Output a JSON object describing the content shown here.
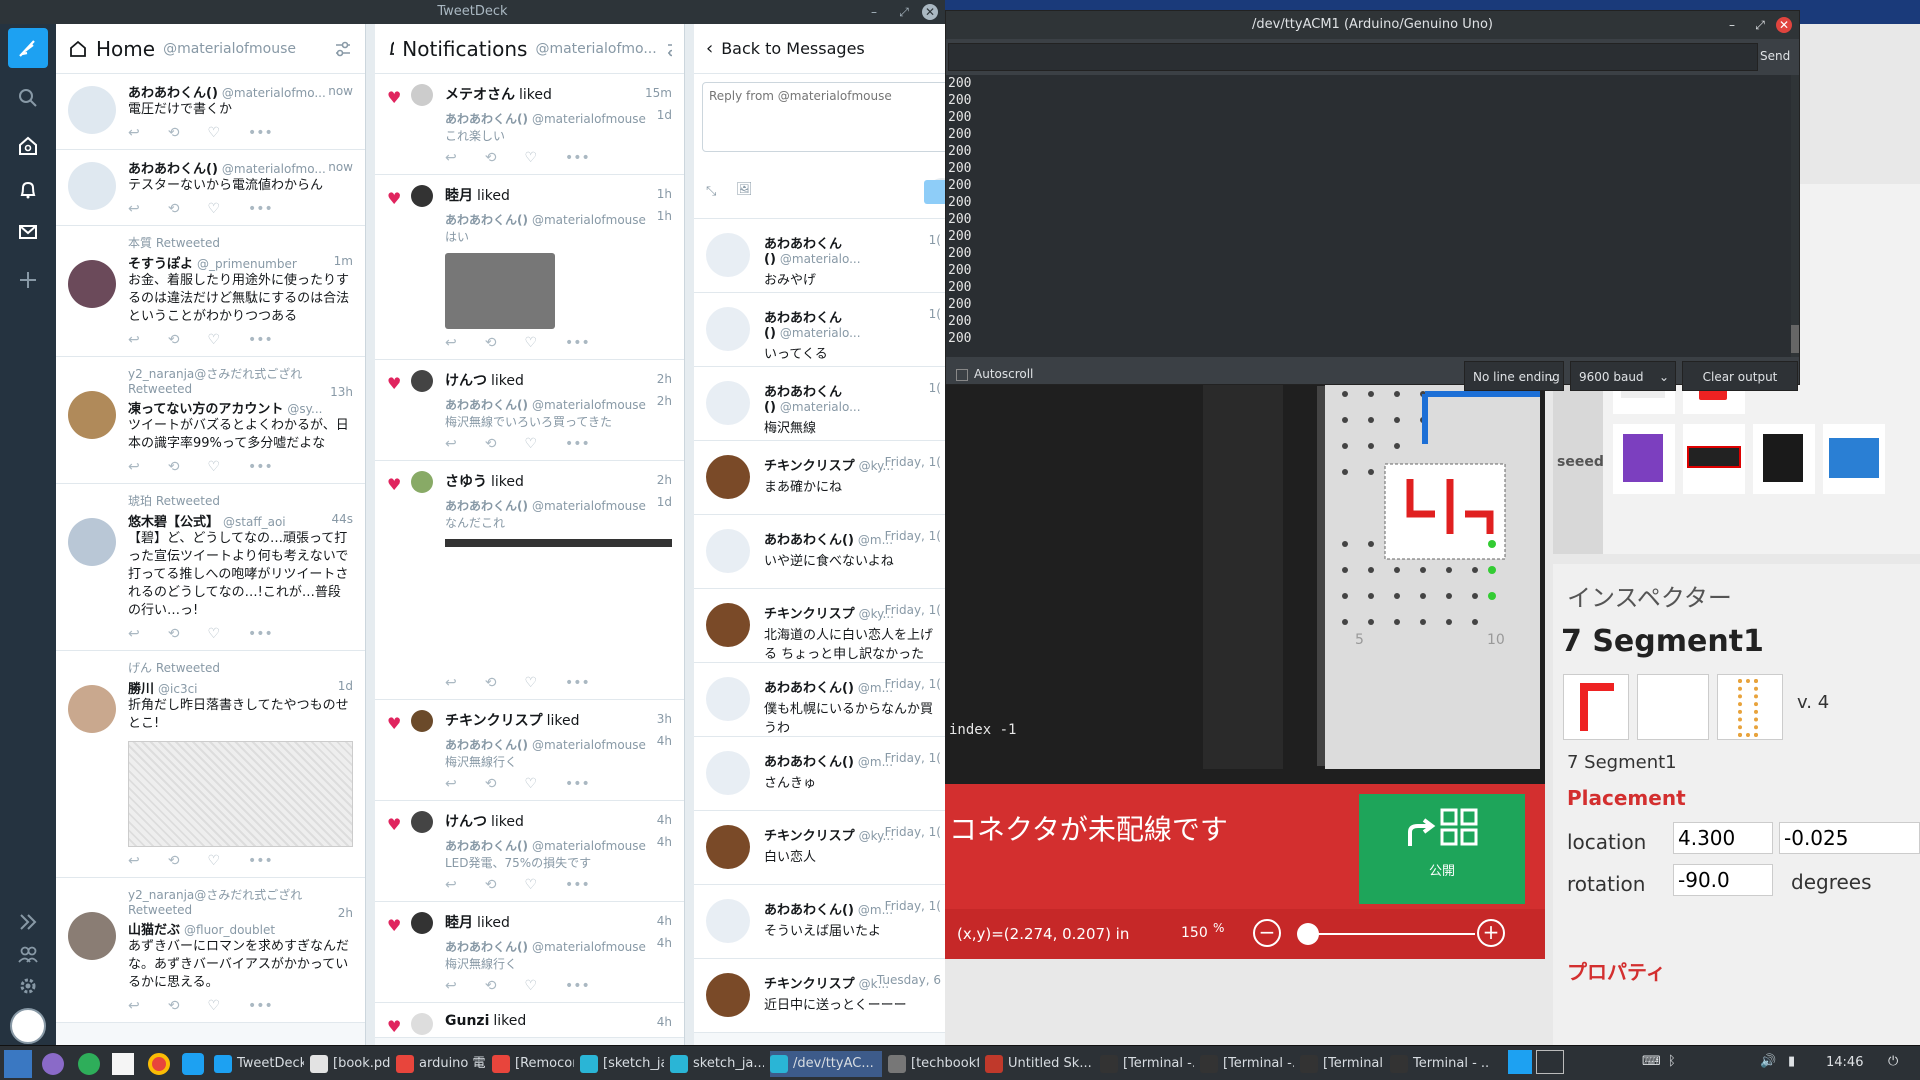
{
  "tweetdeck": {
    "window_title": "TweetDeck",
    "home": {
      "title": "Home",
      "handle": "@materialofmouse",
      "tweets": [
        {
          "retweeter": "",
          "name": "あわあわくん()",
          "handle": "@materialofmo...",
          "time": "now",
          "text": "電圧だけで書くか"
        },
        {
          "retweeter": "",
          "name": "あわあわくん()",
          "handle": "@materialofmo...",
          "time": "now",
          "text": "テスターないから電流値わからん"
        },
        {
          "retweeter": "本質 Retweeted",
          "name": "そすうぽよ",
          "handle": "@_primenumber",
          "time": "1m",
          "text": "お金、着服したり用途外に使ったりするのは違法だけど無駄にするのは合法ということがわかりつつある"
        },
        {
          "retweeter": "y2_naranja@さみだれ式ござれ Retweeted",
          "name": "凍ってない方のアカウント",
          "handle": "@sy...",
          "time": "13h",
          "text": "ツイートがバズるとよくわかるが、日本の識字率99%って多分嘘だよな"
        },
        {
          "retweeter": "琥珀 Retweeted",
          "name": "悠木碧【公式】",
          "handle": "@staff_aoi",
          "time": "44s",
          "text": "【碧】ど、どうしてなの…頑張って打った宣伝ツイートより何も考えないで打ってる推しへの咆哮がリツイートされるのどうしてなの…!これが…普段の行い…っ!"
        },
        {
          "retweeter": "げん Retweeted",
          "name": "勝川",
          "handle": "@ic3ci",
          "time": "1d",
          "text": "折角だし昨日落書きしてたやつものせとこ!"
        },
        {
          "retweeter": "y2_naranja@さみだれ式ござれ Retweeted",
          "name": "山猫だぶ",
          "handle": "@fluor_doublet",
          "time": "2h",
          "text": "あずきバーにロマンを求めすぎなんだな。あずきバーバイアスがかかっているかに思える。"
        }
      ]
    },
    "notifications": {
      "title": "Notifications",
      "handle": "@materialofmo...",
      "items": [
        {
          "who": "メテオさん",
          "action": "liked",
          "time": "15m",
          "time2": "1d",
          "sub_name": "あわあわくん()",
          "sub_handle": "@materialofmouse",
          "text": "これ楽しい"
        },
        {
          "who": "睦月",
          "action": "liked",
          "time": "1h",
          "time2": "1h",
          "sub_name": "あわあわくん()",
          "sub_handle": "@materialofmouse",
          "text": "はい"
        },
        {
          "who": "けんつ",
          "action": "liked",
          "time": "2h",
          "time2": "2h",
          "sub_name": "あわあわくん()",
          "sub_handle": "@materialofmouse",
          "text": "梅沢無線でいろいろ買ってきた"
        },
        {
          "who": "さゆう",
          "action": "liked",
          "time": "2h",
          "time2": "1d",
          "sub_name": "あわあわくん()",
          "sub_handle": "@materialofmouse",
          "text": "なんだこれ"
        },
        {
          "who": "チキンクリスプ",
          "action": "liked",
          "time": "3h",
          "time2": "4h",
          "sub_name": "あわあわくん()",
          "sub_handle": "@materialofmouse",
          "text": "梅沢無線行く"
        },
        {
          "who": "けんつ",
          "action": "liked",
          "time": "4h",
          "time2": "4h",
          "sub_name": "あわあわくん()",
          "sub_handle": "@materialofmouse",
          "text": "LED発電、75%の損失です"
        },
        {
          "who": "睦月",
          "action": "liked",
          "time": "4h",
          "time2": "4h",
          "sub_name": "あわあわくん()",
          "sub_handle": "@materialofmouse",
          "text": "梅沢無線行く"
        },
        {
          "who": "Gunzi",
          "action": "liked",
          "time": "4h",
          "time2": "",
          "sub_name": "",
          "sub_handle": "",
          "text": ""
        }
      ]
    },
    "messages": {
      "back_label": "Back to Messages",
      "reply_placeholder": "Reply from @materialofmouse",
      "items": [
        {
          "name": "あわあわくん()",
          "handle": "@materialo...",
          "time": "1(",
          "text": "おみやげ"
        },
        {
          "name": "あわあわくん()",
          "handle": "@materialo...",
          "time": "1(",
          "text": "いってくる"
        },
        {
          "name": "あわあわくん()",
          "handle": "@materialo...",
          "time": "1(",
          "text": "梅沢無線"
        },
        {
          "name": "チキンクリスプ",
          "handle": "@ky...",
          "time": "Friday, 1(",
          "text": "まあ確かにね"
        },
        {
          "name": "あわあわくん()",
          "handle": "@m...",
          "time": "Friday, 1(",
          "text": "いや逆に食べないよね"
        },
        {
          "name": "チキンクリスプ",
          "handle": "@ky...",
          "time": "Friday, 1(",
          "text": "北海道の人に白い恋人を上げる ちょっと申し訳なかったかもしれ"
        },
        {
          "name": "あわあわくん()",
          "handle": "@m...",
          "time": "Friday, 1(",
          "text": "僕も札幌にいるからなんか買うわ"
        },
        {
          "name": "あわあわくん()",
          "handle": "@m...",
          "time": "Friday, 1(",
          "text": "さんきゅ"
        },
        {
          "name": "チキンクリスプ",
          "handle": "@ky...",
          "time": "Friday, 1(",
          "text": "白い恋人"
        },
        {
          "name": "あわあわくん()",
          "handle": "@m...",
          "time": "Friday, 1(",
          "text": "そういえば届いたよ"
        },
        {
          "name": "チキンクリスプ",
          "handle": "@k...",
          "time": "Tuesday, 6",
          "text": "近日中に送っとくーーー"
        }
      ]
    }
  },
  "serial_monitor": {
    "title": "/dev/ttyACM1 (Arduino/Genuino Uno)",
    "send_label": "Send",
    "lines": [
      "200",
      "200",
      "200",
      "200",
      "200",
      "200",
      "200",
      "200",
      "200",
      "200",
      "200",
      "200",
      "200",
      "200",
      "200",
      "200"
    ],
    "autoscroll_label": "Autoscroll",
    "line_ending": "No line ending",
    "baud": "9600 baud",
    "clear_label": "Clear output"
  },
  "fritzing": {
    "console_text": "index -1",
    "unrouted_msg": "コネクタが未配線です",
    "share_label": "公開",
    "coords": "(x,y)=(2.274, 0.207) in",
    "zoom": "150",
    "zoom_unit": "%",
    "ruler_5": "5",
    "ruler_10": "10",
    "seeed_label": "seeed",
    "inspector_title": "インスペクター",
    "part_title": "7 Segment1",
    "part_version": "v. 4",
    "part_name": "7 Segment1",
    "placement_label": "Placement",
    "location_label": "location",
    "location_x": "4.300",
    "location_y": "-0.025",
    "rotation_label": "rotation",
    "rotation_value": "-90.0",
    "rotation_unit": "degrees",
    "properties_label": "プロパティ"
  },
  "taskbar": {
    "items": [
      "TweetDeck",
      "[book.pdf ...",
      "arduino 電...",
      "[Remocon...",
      "[sketch_ja...",
      "sketch_ja...",
      "/dev/ttyAC...",
      "[techbookf...",
      "Untitled Sk...",
      "[Terminal -...",
      "[Terminal -...",
      "[Terminal -...",
      "Terminal - ..."
    ],
    "clock": "14:46"
  }
}
